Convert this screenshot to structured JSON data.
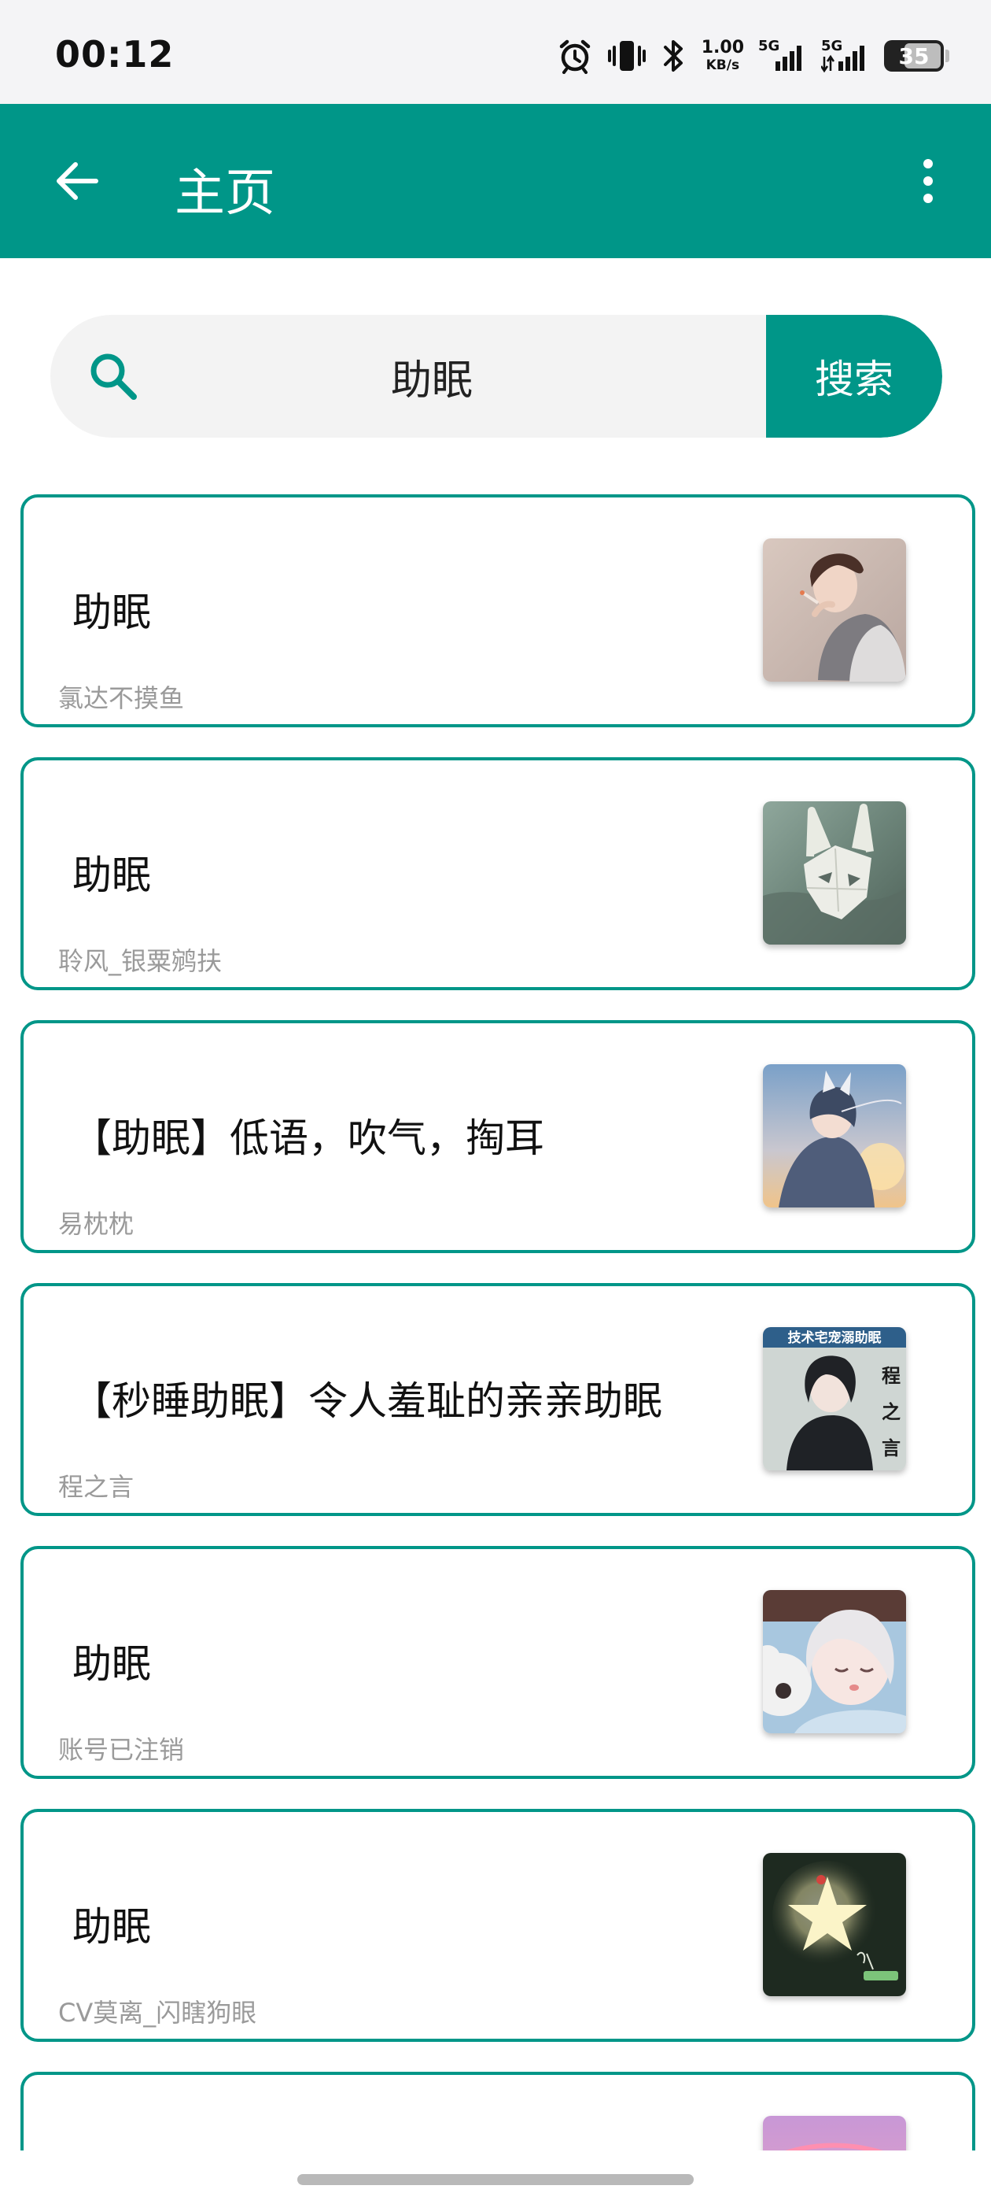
{
  "status_bar": {
    "time": "00:12",
    "net_speed_value": "1.00",
    "net_speed_unit": "KB/s",
    "sim1_label": "5G",
    "sim2_label": "5G",
    "battery": "35",
    "icons": [
      "alarm-icon",
      "vibrate-icon",
      "bluetooth-icon",
      "signal-icon",
      "signal-icon",
      "battery-icon"
    ]
  },
  "app_bar": {
    "title": "主页",
    "back_icon": "arrow-back-icon",
    "menu_icon": "more-vert-icon"
  },
  "search": {
    "value": "助眠",
    "button_label": "搜索"
  },
  "results": [
    {
      "title": "助眠",
      "author": "氯达不摸鱼",
      "thumb": "anime-boy-smoking"
    },
    {
      "title": "助眠",
      "author": "聆风_银粟鹓扶",
      "thumb": "white-rabbit-mask"
    },
    {
      "title": "【助眠】低语，吹气，掏耳",
      "author": "易枕枕",
      "thumb": "fox-girl-sunset"
    },
    {
      "title": "【秒睡助眠】令人羞耻的亲亲助眠",
      "author": "程之言",
      "thumb": "cover-程之言"
    },
    {
      "title": "助眠",
      "author": "账号已注销",
      "thumb": "sleeping-girl-bear"
    },
    {
      "title": "助眠",
      "author": "CV莫离_闪瞎狗眼",
      "thumb": "glowing-star"
    },
    {
      "title": "",
      "author": "",
      "thumb": "pink-sky"
    }
  ],
  "thumb_cover_text": {
    "banner": "技术宅宠溺助眠",
    "side": [
      "程",
      "之",
      "言"
    ]
  },
  "colors": {
    "primary": "#009688",
    "card_border": "#009688",
    "author_text": "#9a9a9a"
  }
}
